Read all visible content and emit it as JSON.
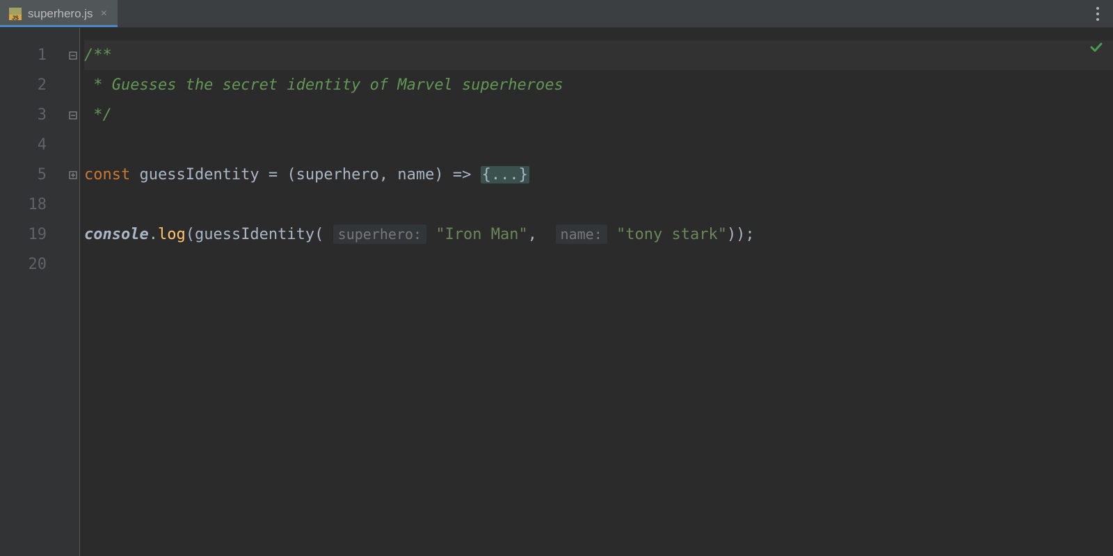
{
  "tab": {
    "filename": "superhero.js",
    "close": "×"
  },
  "gutter": {
    "lines": [
      "1",
      "2",
      "3",
      "4",
      "5",
      "18",
      "19",
      "20"
    ]
  },
  "code": {
    "l1": "/**",
    "l2": " * Guesses the secret identity of Marvel superheroes",
    "l3": " */",
    "l5_const": "const",
    "l5_name": " guessIdentity ",
    "l5_eq": "= ",
    "l5_params": "(superhero, name) ",
    "l5_arrow": "=> ",
    "l5_fold": "{...}",
    "l19_console": "console",
    "l19_dot": ".",
    "l19_log": "log",
    "l19_open": "(guessIdentity(",
    "l19_hint1": "superhero:",
    "l19_str1": " \"Iron Man\"",
    "l19_comma": ", ",
    "l19_hint2": "name:",
    "l19_str2": " \"tony stark\"",
    "l19_close": "));"
  }
}
